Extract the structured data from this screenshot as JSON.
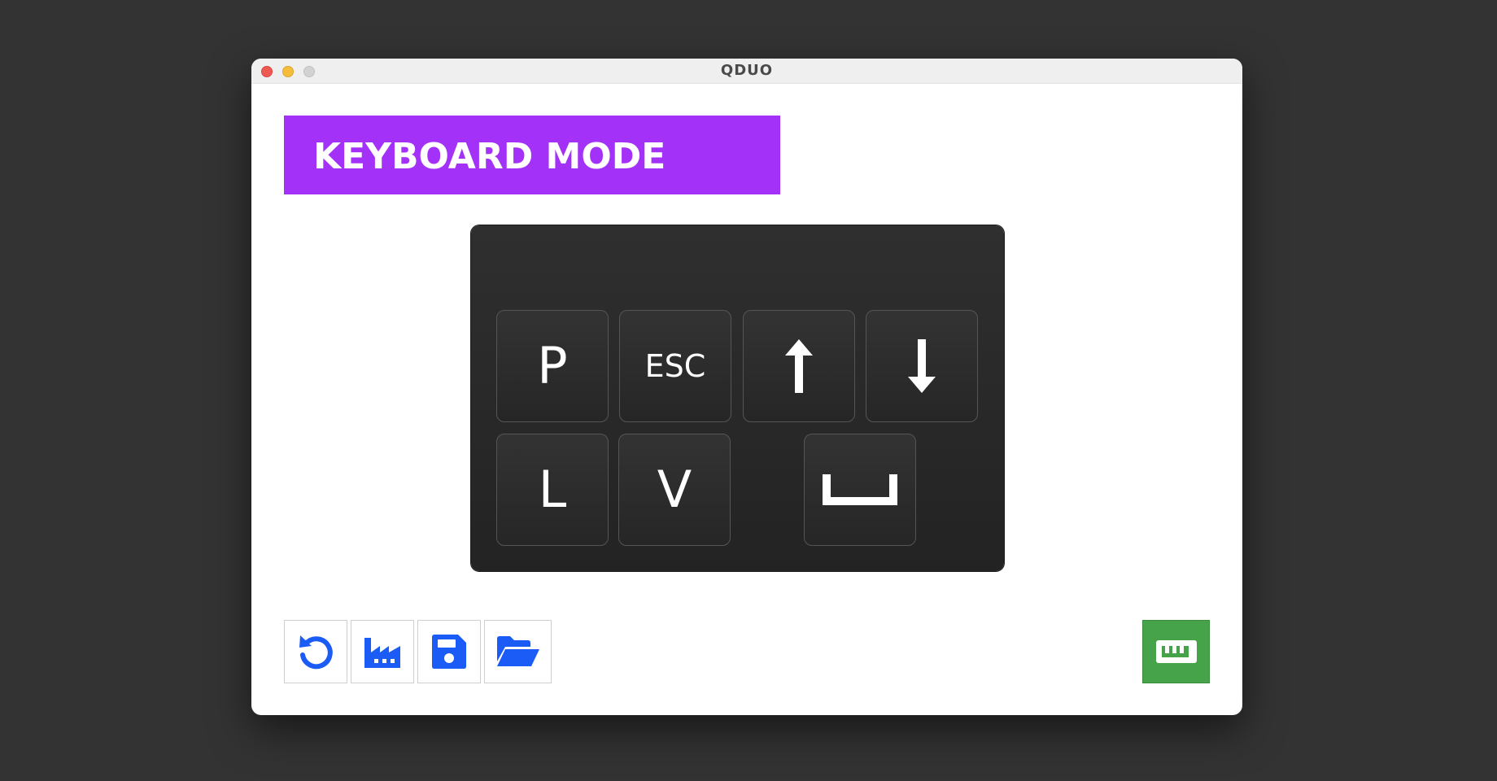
{
  "window": {
    "title": "QDUO"
  },
  "mode_banner": {
    "label": "KEYBOARD MODE",
    "color": "#a431f7"
  },
  "keypad": {
    "keys": [
      {
        "label": "P",
        "icon": null
      },
      {
        "label": "ESC",
        "icon": null
      },
      {
        "label": "",
        "icon": "arrow-up-icon"
      },
      {
        "label": "",
        "icon": "arrow-down-icon"
      },
      {
        "label": "L",
        "icon": null
      },
      {
        "label": "V",
        "icon": null
      },
      {
        "label": "",
        "icon": "space-bar-icon"
      }
    ]
  },
  "toolbar": {
    "accent_color": "#1a5cf5",
    "buttons": [
      {
        "icon": "undo-icon"
      },
      {
        "icon": "factory-icon"
      },
      {
        "icon": "floppy-disk-icon"
      },
      {
        "icon": "open-folder-icon"
      }
    ]
  },
  "keyboard_toggle": {
    "icon": "keyboard-icon",
    "color": "#46a34a"
  }
}
